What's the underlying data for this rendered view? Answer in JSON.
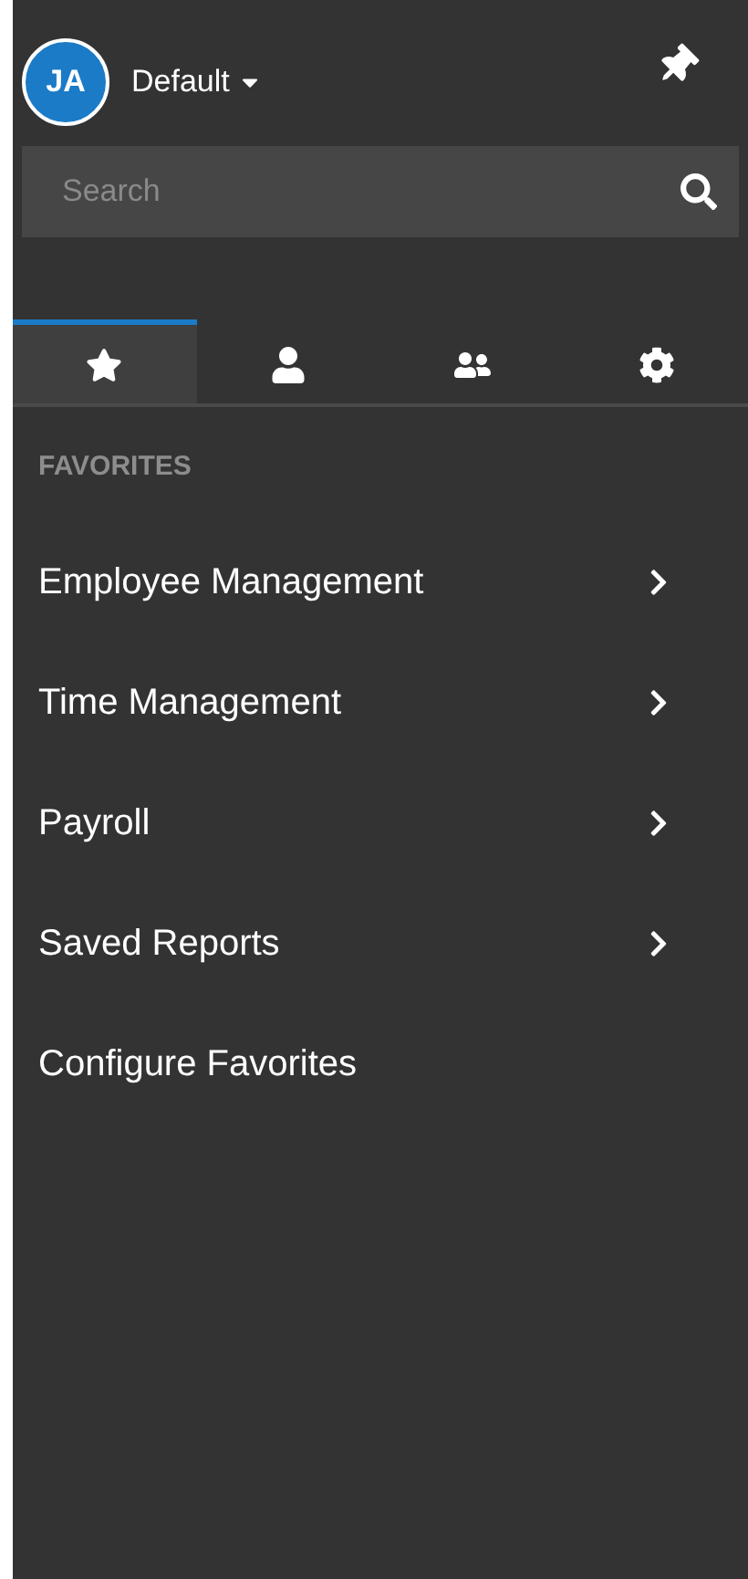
{
  "header": {
    "avatar_initials": "JA",
    "profile": "Default"
  },
  "search": {
    "placeholder": "Search"
  },
  "tabs": [
    {
      "kind": "favorites",
      "selected": true
    },
    {
      "kind": "person",
      "selected": false
    },
    {
      "kind": "people",
      "selected": false
    },
    {
      "kind": "settings",
      "selected": false
    }
  ],
  "section_title": "FAVORITES",
  "items": [
    {
      "label": "Employee Management",
      "kind": "submenu"
    },
    {
      "label": "Time Management",
      "kind": "submenu"
    },
    {
      "label": "Payroll",
      "kind": "submenu"
    },
    {
      "label": "Saved Reports",
      "kind": "submenu"
    },
    {
      "label": "Configure Favorites",
      "kind": "link"
    }
  ]
}
